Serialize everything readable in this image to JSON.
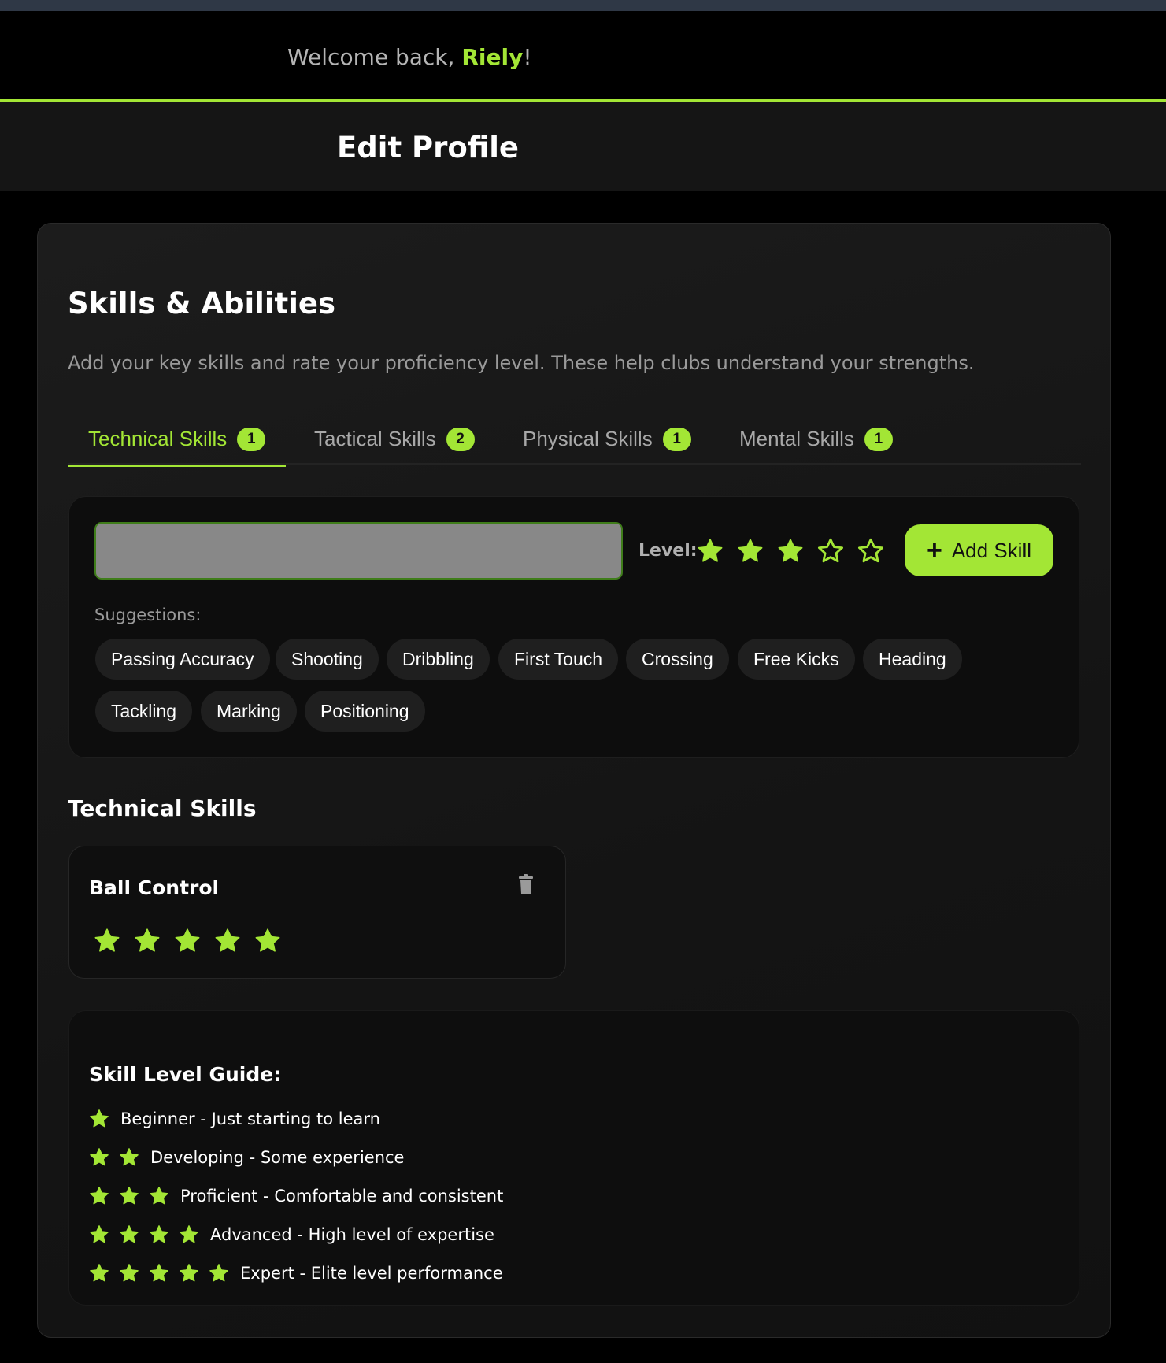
{
  "header": {
    "welcome_prefix": "Welcome back, ",
    "user_name": "Riely",
    "welcome_suffix": "!",
    "page_title": "Edit Profile"
  },
  "section": {
    "title": "Skills & Abilities",
    "description": "Add your key skills and rate your proficiency level. These help clubs understand your strengths."
  },
  "tabs": [
    {
      "label": "Technical Skills",
      "count": "1",
      "active": true
    },
    {
      "label": "Tactical Skills",
      "count": "2",
      "active": false
    },
    {
      "label": "Physical Skills",
      "count": "1",
      "active": false
    },
    {
      "label": "Mental Skills",
      "count": "1",
      "active": false
    }
  ],
  "add_skill": {
    "input_value": "",
    "input_placeholder": "",
    "level_label": "Level:",
    "level_rating": 3,
    "level_max": 5,
    "button_label": "Add Skill",
    "suggestions_label": "Suggestions:",
    "suggestions": [
      "Passing Accuracy",
      "Shooting",
      "Dribbling",
      "First Touch",
      "Crossing",
      "Free Kicks",
      "Heading",
      "Tackling",
      "Marking",
      "Positioning"
    ]
  },
  "skills_list": {
    "title": "Technical Skills",
    "items": [
      {
        "name": "Ball Control",
        "rating": 5
      }
    ]
  },
  "guide": {
    "title": "Skill Level Guide:",
    "levels": [
      {
        "stars": 1,
        "text": "Beginner - Just starting to learn"
      },
      {
        "stars": 2,
        "text": "Developing - Some experience"
      },
      {
        "stars": 3,
        "text": "Proficient - Comfortable and consistent"
      },
      {
        "stars": 4,
        "text": "Advanced - High level of expertise"
      },
      {
        "stars": 5,
        "text": "Expert - Elite level performance"
      }
    ]
  },
  "colors": {
    "accent": "#a3e635",
    "background": "#000000",
    "card": "#161616"
  },
  "icons": {
    "star": "star-icon",
    "plus": "plus-icon",
    "trash": "trash-icon"
  }
}
